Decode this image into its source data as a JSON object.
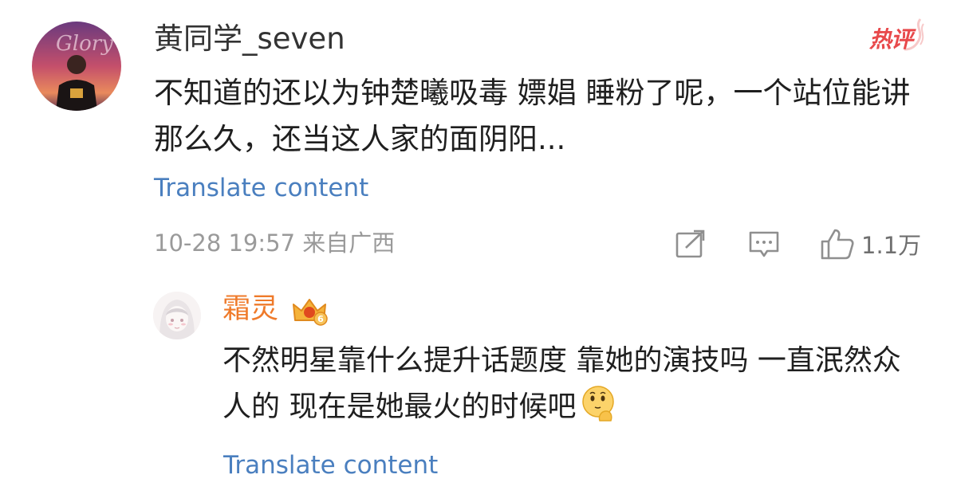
{
  "main_comment": {
    "username": "黄同学_seven",
    "hot_label": "热评",
    "text": "不知道的还以为钟楚曦吸毒 嫖娼 睡粉了呢，一个站位能讲那么久，还当这人家的面阴阳...",
    "translate_label": "Translate content",
    "timestamp": "10-28 19:57",
    "location": "来自广西",
    "like_count": "1.1万",
    "avatar_icon": "user-avatar-photo",
    "avatar_overlay_text": "Glory"
  },
  "reply": {
    "username": "霜灵",
    "badge_icon": "vip-crown-badge",
    "badge_level": "6",
    "text": "不然明星靠什么提升话题度 靠她的演技吗 一直泯然众人的 现在是她最火的时候吧",
    "emoji_icon": "thinking-emoji",
    "translate_label": "Translate content",
    "avatar_icon": "anime-girl-avatar"
  },
  "colors": {
    "link_blue": "#4a7fbf",
    "hot_red": "#e8494b",
    "vip_orange": "#ef7a2a",
    "meta_gray": "#9a9a9a"
  }
}
